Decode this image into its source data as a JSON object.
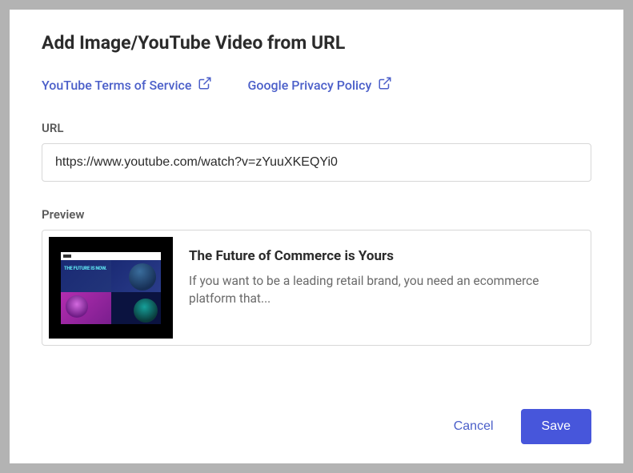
{
  "dialog": {
    "title": "Add Image/YouTube Video from URL",
    "links": {
      "youtube_tos": "YouTube Terms of Service",
      "google_privacy": "Google Privacy Policy"
    },
    "url_field": {
      "label": "URL",
      "value": "https://www.youtube.com/watch?v=zYuuXKEQYi0"
    },
    "preview": {
      "label": "Preview",
      "title": "The Future of Commerce is Yours",
      "description": "If you want to be a leading retail brand, you need an ecommerce platform that...",
      "thumb_text": "THE FUTURE IS NOW."
    },
    "footer": {
      "cancel": "Cancel",
      "save": "Save"
    }
  }
}
